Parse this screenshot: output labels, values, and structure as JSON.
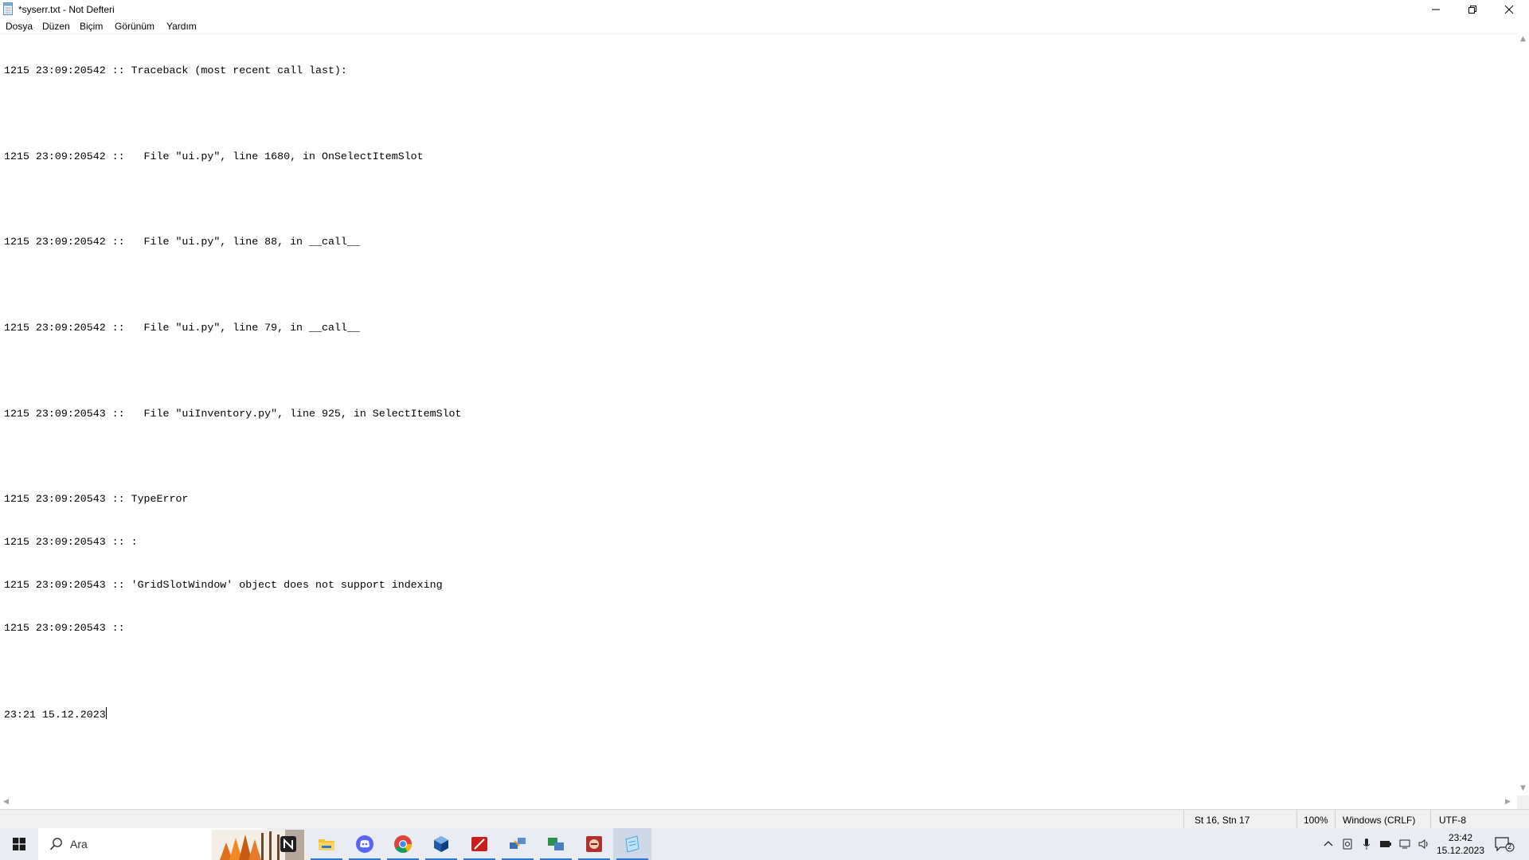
{
  "window": {
    "title": "*syserr.txt - Not Defteri"
  },
  "menu": [
    "Dosya",
    "Düzen",
    "Biçim",
    "Görünüm",
    "Yardım"
  ],
  "editor": {
    "lines": [
      "1215 23:09:20542 :: Traceback (most recent call last):",
      "",
      "1215 23:09:20542 ::   File \"ui.py\", line 1680, in OnSelectItemSlot",
      "",
      "1215 23:09:20542 ::   File \"ui.py\", line 88, in __call__",
      "",
      "1215 23:09:20542 ::   File \"ui.py\", line 79, in __call__",
      "",
      "1215 23:09:20543 ::   File \"uiInventory.py\", line 925, in SelectItemSlot",
      "",
      "1215 23:09:20543 :: TypeError",
      "1215 23:09:20543 :: :",
      "1215 23:09:20543 :: 'GridSlotWindow' object does not support indexing",
      "1215 23:09:20543 :: ",
      "",
      "23:21 15.12.2023"
    ]
  },
  "status": {
    "position": "St 16, Stn 17",
    "zoom": "100%",
    "line_ending": "Windows (CRLF)",
    "encoding": "UTF-8"
  },
  "taskbar": {
    "search_placeholder": "Ara",
    "apps": [
      {
        "name": "notion",
        "color": "#1f1f1f"
      },
      {
        "name": "file-explorer",
        "color": "#f4c430"
      },
      {
        "name": "discord",
        "color": "#5865f2"
      },
      {
        "name": "chrome",
        "color": "#db4437"
      },
      {
        "name": "virtualbox",
        "color": "#1e5aa8"
      },
      {
        "name": "red-app",
        "color": "#c81e1e"
      },
      {
        "name": "network-tool",
        "color": "#3b6fb6"
      },
      {
        "name": "transfer-tool",
        "color": "#2f8f4f"
      },
      {
        "name": "game-app",
        "color": "#b03030"
      },
      {
        "name": "notepad",
        "color": "#4fa3d9"
      }
    ],
    "time": "23:42",
    "date": "15.12.2023",
    "notification_count": "2"
  },
  "colors": {
    "taskbar_bg": "#e9edf3",
    "accent": "#2b79d0"
  }
}
